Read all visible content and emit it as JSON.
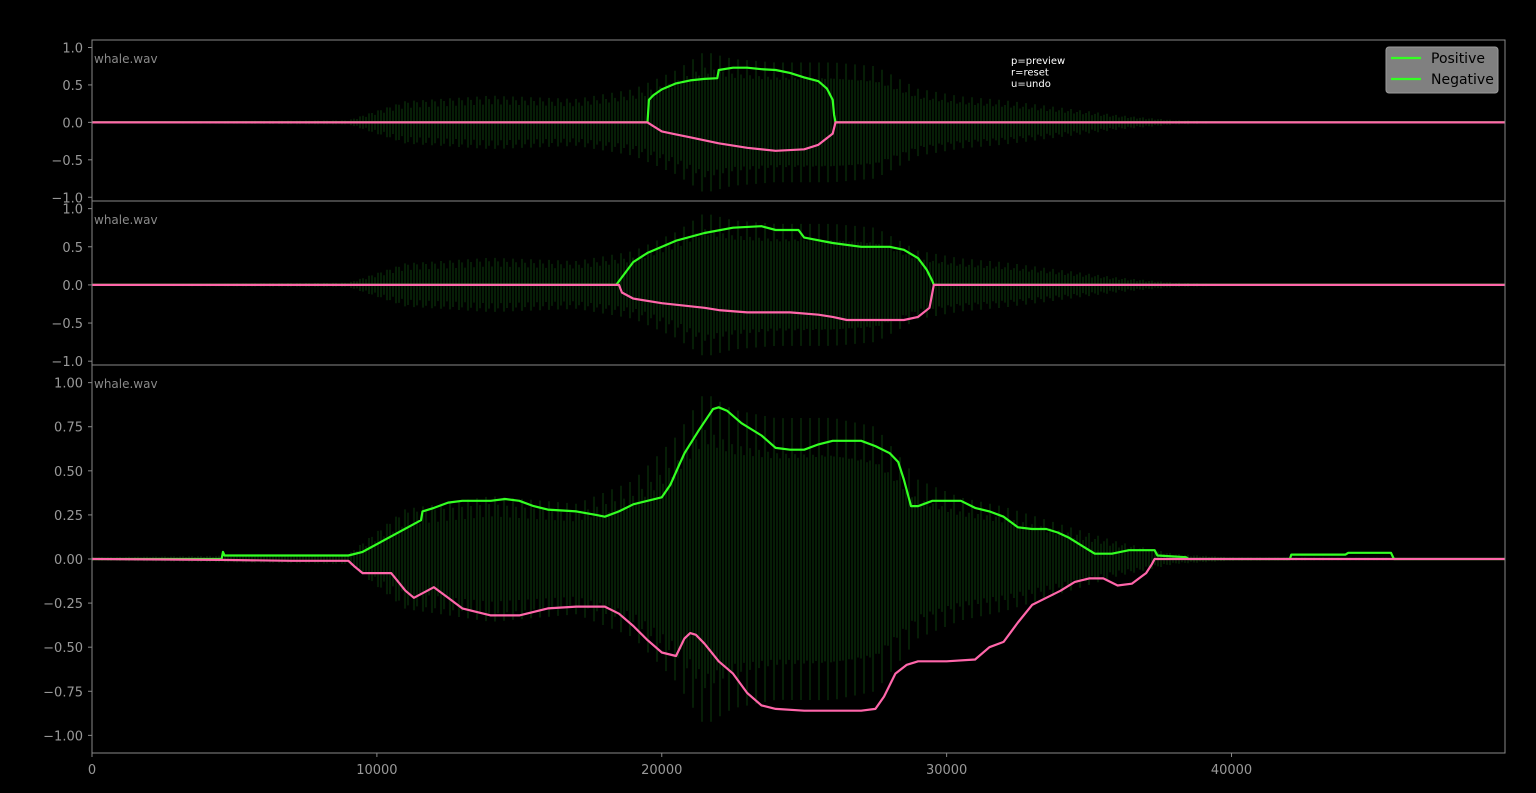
{
  "colors": {
    "background": "#000000",
    "axis": "#888888",
    "tick_label": "#999999",
    "waveform": "#0b3d0b",
    "positive": "#33ff22",
    "negative": "#ff66aa",
    "legend_bg": "#808080",
    "help_text": "#ffffff"
  },
  "help_text": [
    "p=preview",
    "r=reset",
    "u=undo"
  ],
  "legend": {
    "placement": "top-right",
    "entries": [
      {
        "label": "Positive",
        "color": "#33ff22"
      },
      {
        "label": "Negative",
        "color": "#33ff22"
      }
    ]
  },
  "chart_data": [
    {
      "type": "line",
      "file_label": "whale.wav",
      "xlim": [
        0,
        49600
      ],
      "ylim": [
        -1.05,
        1.1
      ],
      "yticks": [
        -1.0,
        -0.5,
        0.0,
        0.5,
        1.0
      ],
      "ytick_labels": [
        "−1.0",
        "−0.5",
        "0.0",
        "0.5",
        "1.0"
      ],
      "waveform_envelope": {
        "x": [
          0,
          9000,
          11000,
          14000,
          17000,
          19000,
          20500,
          21500,
          22500,
          24000,
          26000,
          27500,
          29000,
          30500,
          32000,
          34000,
          36000,
          38000,
          40000,
          49600
        ],
        "y": [
          0.01,
          0.03,
          0.3,
          0.37,
          0.32,
          0.45,
          0.7,
          0.95,
          0.85,
          0.8,
          0.8,
          0.75,
          0.45,
          0.35,
          0.3,
          0.2,
          0.1,
          0.03,
          0.01,
          0.005
        ]
      },
      "series": [
        {
          "name": "Positive",
          "x": [
            0,
            19500,
            19550,
            19700,
            20000,
            20500,
            21000,
            21500,
            21950,
            22000,
            22500,
            23000,
            23500,
            24000,
            24500,
            25000,
            25500,
            25800,
            26000,
            26050,
            26100,
            49600
          ],
          "y": [
            0,
            0,
            0.3,
            0.36,
            0.44,
            0.52,
            0.56,
            0.58,
            0.59,
            0.7,
            0.73,
            0.73,
            0.71,
            0.7,
            0.66,
            0.6,
            0.55,
            0.45,
            0.3,
            0.1,
            0,
            0
          ]
        },
        {
          "name": "Negative",
          "x": [
            0,
            19500,
            19700,
            20000,
            20500,
            21000,
            22000,
            23000,
            24000,
            25000,
            25500,
            26000,
            26100,
            49600
          ],
          "y": [
            0,
            0,
            -0.05,
            -0.12,
            -0.16,
            -0.2,
            -0.28,
            -0.34,
            -0.38,
            -0.36,
            -0.3,
            -0.15,
            0,
            0
          ]
        }
      ]
    },
    {
      "type": "line",
      "file_label": "whale.wav",
      "xlim": [
        0,
        49600
      ],
      "ylim": [
        -1.05,
        1.1
      ],
      "yticks": [
        -1.0,
        -0.5,
        0.0,
        0.5,
        1.0
      ],
      "ytick_labels": [
        "−1.0",
        "−0.5",
        "0.0",
        "0.5",
        "1.0"
      ],
      "waveform_envelope": {
        "x": [
          0,
          9000,
          11000,
          14000,
          17000,
          19000,
          20500,
          21500,
          22500,
          24000,
          26000,
          27500,
          29000,
          30500,
          32000,
          34000,
          36000,
          38000,
          40000,
          49600
        ],
        "y": [
          0.01,
          0.03,
          0.3,
          0.37,
          0.32,
          0.45,
          0.7,
          0.95,
          0.85,
          0.8,
          0.8,
          0.75,
          0.45,
          0.35,
          0.3,
          0.2,
          0.1,
          0.03,
          0.01,
          0.005
        ]
      },
      "series": [
        {
          "name": "Positive",
          "x": [
            0,
            18400,
            18500,
            19000,
            19500,
            20500,
            21500,
            22500,
            23500,
            24000,
            24800,
            25000,
            26000,
            27000,
            28000,
            28500,
            29000,
            29300,
            29500,
            29550,
            49600
          ],
          "y": [
            0,
            0,
            0.05,
            0.3,
            0.42,
            0.58,
            0.68,
            0.75,
            0.77,
            0.72,
            0.72,
            0.62,
            0.55,
            0.5,
            0.5,
            0.46,
            0.35,
            0.2,
            0.05,
            0,
            0
          ]
        },
        {
          "name": "Negative",
          "x": [
            0,
            18500,
            18600,
            19000,
            20000,
            21500,
            22000,
            23000,
            24500,
            25500,
            26000,
            26500,
            27500,
            28500,
            29000,
            29400,
            29500,
            29550,
            49600
          ],
          "y": [
            0,
            0,
            -0.1,
            -0.18,
            -0.24,
            -0.3,
            -0.33,
            -0.36,
            -0.36,
            -0.39,
            -0.42,
            -0.46,
            -0.46,
            -0.46,
            -0.42,
            -0.3,
            -0.1,
            0,
            0
          ]
        }
      ]
    },
    {
      "type": "line",
      "file_label": "whale.wav",
      "xlim": [
        0,
        49600
      ],
      "ylim": [
        -1.1,
        1.1
      ],
      "yticks": [
        -1.0,
        -0.75,
        -0.5,
        -0.25,
        0.0,
        0.25,
        0.5,
        0.75,
        1.0
      ],
      "ytick_labels": [
        "−1.00",
        "−0.75",
        "−0.50",
        "−0.25",
        "0.00",
        "0.25",
        "0.50",
        "0.75",
        "1.00"
      ],
      "xticks": [
        0,
        10000,
        20000,
        30000,
        40000
      ],
      "xtick_labels": [
        "0",
        "10000",
        "20000",
        "30000",
        "40000"
      ],
      "waveform_envelope": {
        "x": [
          0,
          9000,
          11000,
          14000,
          17000,
          19000,
          20500,
          21500,
          22500,
          24000,
          26000,
          27500,
          29000,
          30500,
          32000,
          34000,
          36000,
          38000,
          40000,
          49600
        ],
        "y": [
          0.01,
          0.03,
          0.3,
          0.37,
          0.32,
          0.45,
          0.7,
          0.95,
          0.85,
          0.8,
          0.8,
          0.75,
          0.45,
          0.35,
          0.3,
          0.2,
          0.1,
          0.03,
          0.01,
          0.005
        ]
      },
      "series": [
        {
          "name": "Positive",
          "x": [
            0,
            4550,
            4600,
            4650,
            9000,
            9500,
            11550,
            11600,
            12000,
            12500,
            13000,
            14000,
            14500,
            15000,
            15500,
            16000,
            17000,
            17700,
            18000,
            18500,
            19000,
            19500,
            20000,
            20300,
            20600,
            20800,
            21300,
            21800,
            22000,
            22300,
            22800,
            23500,
            24000,
            24500,
            25000,
            25500,
            26000,
            27000,
            27500,
            28000,
            28300,
            28500,
            28700,
            28750,
            29000,
            29500,
            30500,
            31000,
            31500,
            32000,
            32500,
            33000,
            33400,
            33500,
            33900,
            34300,
            34800,
            35200,
            35800,
            36400,
            36700,
            37300,
            37400,
            38400,
            38500,
            40000,
            42050,
            42100,
            43000,
            44000,
            44100,
            45600,
            45700,
            49600
          ],
          "y": [
            0,
            0,
            0.04,
            0.02,
            0.02,
            0.04,
            0.22,
            0.27,
            0.29,
            0.32,
            0.33,
            0.33,
            0.34,
            0.33,
            0.3,
            0.28,
            0.27,
            0.25,
            0.24,
            0.27,
            0.31,
            0.33,
            0.35,
            0.42,
            0.53,
            0.6,
            0.73,
            0.85,
            0.86,
            0.84,
            0.77,
            0.7,
            0.63,
            0.62,
            0.62,
            0.65,
            0.67,
            0.67,
            0.64,
            0.6,
            0.55,
            0.45,
            0.33,
            0.3,
            0.3,
            0.33,
            0.33,
            0.29,
            0.27,
            0.24,
            0.18,
            0.17,
            0.17,
            0.17,
            0.15,
            0.12,
            0.07,
            0.03,
            0.03,
            0.05,
            0.05,
            0.05,
            0.02,
            0.01,
            0,
            0,
            0,
            0.025,
            0.025,
            0.025,
            0.035,
            0.035,
            0,
            0
          ]
        },
        {
          "name": "Negative",
          "x": [
            0,
            4500,
            7000,
            9000,
            9200,
            9500,
            10500,
            10600,
            11000,
            11300,
            12000,
            12500,
            13000,
            14000,
            15000,
            15500,
            16000,
            17000,
            18000,
            18500,
            19000,
            19500,
            20000,
            20500,
            20800,
            21000,
            21200,
            21500,
            22000,
            22500,
            23000,
            23500,
            24000,
            25000,
            26000,
            27000,
            27500,
            27800,
            28200,
            28600,
            29000,
            30000,
            31000,
            31500,
            32000,
            32500,
            33000,
            33500,
            34000,
            34500,
            35000,
            35500,
            36000,
            36500,
            37000,
            37200,
            37300,
            49600
          ],
          "y": [
            0,
            -0.005,
            -0.01,
            -0.01,
            -0.04,
            -0.08,
            -0.08,
            -0.1,
            -0.18,
            -0.22,
            -0.16,
            -0.22,
            -0.28,
            -0.32,
            -0.32,
            -0.3,
            -0.28,
            -0.27,
            -0.27,
            -0.31,
            -0.38,
            -0.46,
            -0.53,
            -0.55,
            -0.45,
            -0.42,
            -0.43,
            -0.48,
            -0.58,
            -0.65,
            -0.76,
            -0.83,
            -0.85,
            -0.86,
            -0.86,
            -0.86,
            -0.85,
            -0.78,
            -0.65,
            -0.6,
            -0.58,
            -0.58,
            -0.57,
            -0.5,
            -0.47,
            -0.36,
            -0.26,
            -0.22,
            -0.18,
            -0.13,
            -0.11,
            -0.11,
            -0.15,
            -0.14,
            -0.08,
            -0.03,
            0,
            0
          ]
        }
      ]
    }
  ]
}
